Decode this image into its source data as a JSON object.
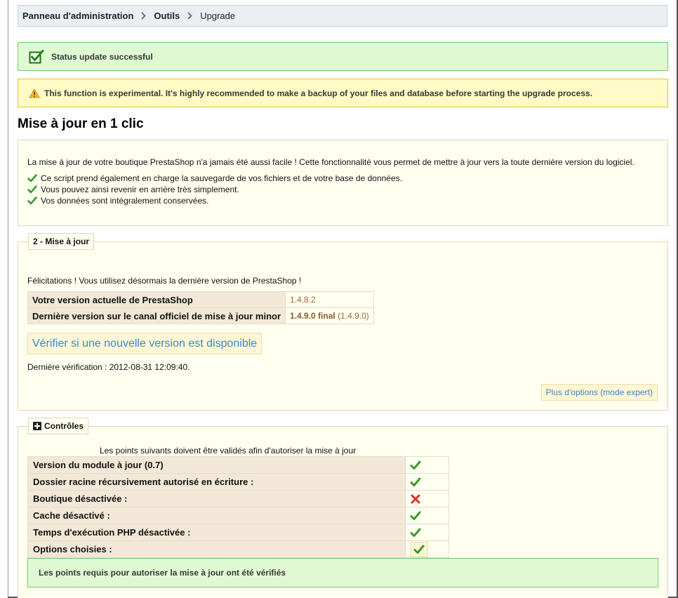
{
  "breadcrumb": {
    "items": [
      "Panneau d'administration",
      "Outils",
      "Upgrade"
    ]
  },
  "alerts": {
    "success": "Status update successful",
    "warning": "This function is experimental. It's highly recommended to make a backup of your files and database before starting the upgrade process."
  },
  "page_title": "Mise à jour en 1 clic",
  "intro": {
    "text": "La mise à jour de votre boutique PrestaShop n'a jamais été aussi facile ! Cette fonctionnalité vous permet de mettre à jour vers la toute dernière version du logiciel.",
    "features": [
      "Ce script prend également en charge la sauvegarde de vos fichiers et de votre base de données.",
      "Vous pouvez ainsi revenir en arrière très simplement.",
      "Vos données sont intégralement conservées."
    ]
  },
  "upgrade": {
    "legend": "2 - Mise à jour",
    "congrats": "Félicitations ! Vous utilisez désormais la dernière version de PrestaShop !",
    "current_label": "Votre version actuelle de PrestaShop",
    "current_value": "1.4.8.2",
    "latest_label": "Dernière version sur le canal officiel de mise à jour minor",
    "latest_name": "1.4.9.0 final",
    "latest_version": "(1.4.9.0)",
    "check_button": "Vérifier si une nouvelle version est disponible",
    "last_check": "Dernière vérification : 2012-08-31 12:09:40.",
    "expert_button": "Plus d'options (mode expert)"
  },
  "controls": {
    "legend": "Contrôles",
    "intro": "Les points suivants doivent être validés afin d'autoriser la mise à jour",
    "rows": [
      {
        "label": "Version du module à jour (0.7)",
        "status": "ok"
      },
      {
        "label": "Dossier racine récursivement autorisé en écriture :",
        "status": "ok"
      },
      {
        "label": "Boutique désactivée :",
        "status": "fail"
      },
      {
        "label": "Cache désactivé :",
        "status": "ok"
      },
      {
        "label": "Temps d'exécution PHP désactivée :",
        "status": "ok"
      },
      {
        "label": "Options choisies :",
        "status": "ok"
      }
    ],
    "result": "Les points requis pour autoriser la mise à jour ont été vérifiés"
  },
  "colors": {
    "success_bg": "#dffad3",
    "warning_bg": "#fffac6",
    "link": "#3a89c9",
    "check_green": "#3a9a2a",
    "cross_red": "#d9312b"
  }
}
